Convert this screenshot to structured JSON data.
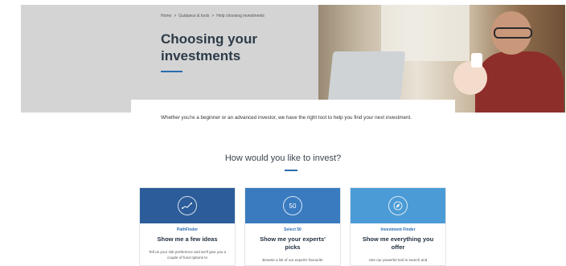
{
  "hero": {
    "breadcrumb": [
      "Home",
      ">",
      "Guidance & tools",
      ">",
      "Help choosing investments"
    ],
    "title": "Choosing your investments",
    "background_color": "#d4d4d4",
    "accent_color": "#2b6cb0"
  },
  "intro": {
    "text": "Whether you're a beginner or an advanced investor, we have the right tool to help you find your next investment."
  },
  "section": {
    "heading": "How would you like to invest?"
  },
  "cards": [
    {
      "eyebrow": "PathFinder",
      "title": "Show me a few ideas",
      "description": "Tell us your risk preference and we'll give you a couple of fund options to",
      "icon": "path-chart-icon",
      "icon_text": "",
      "color": "#2c5d9a"
    },
    {
      "eyebrow": "Select 50",
      "title": "Show me your experts' picks",
      "description": "Browse a list of our experts' favourite",
      "icon": "select-50-icon",
      "icon_text": "50",
      "color": "#3a7bc0"
    },
    {
      "eyebrow": "Investment Finder",
      "title": "Show me everything you offer",
      "description": "Use our powerful tool to search and",
      "icon": "compass-icon",
      "icon_text": "",
      "color": "#4b9bd6"
    }
  ]
}
